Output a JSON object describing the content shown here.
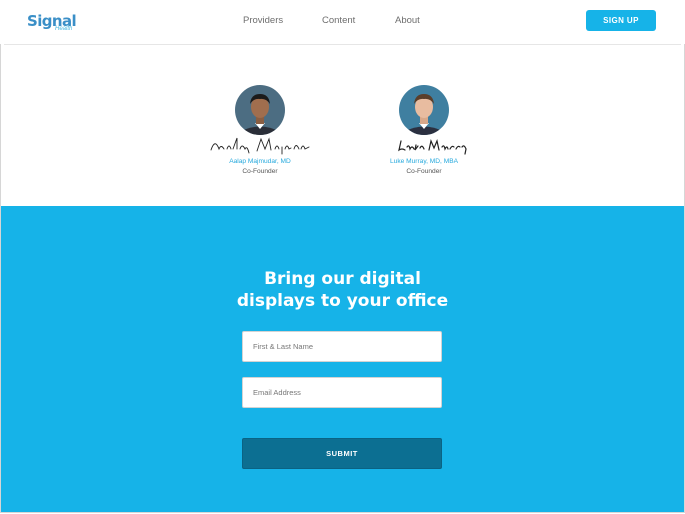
{
  "brand": {
    "logo_text": "Signal",
    "logo_sub": "Health",
    "primary_color": "#16b3e8",
    "accent_text_color": "#26a9dd"
  },
  "header": {
    "nav": [
      "Providers",
      "Content",
      "About"
    ],
    "signup_label": "SIGN UP"
  },
  "founders": [
    {
      "name": "Aalap Majmudar, MD",
      "role": "Co-Founder",
      "icon": "portrait-photo"
    },
    {
      "name": "Luke Murray, MD, MBA",
      "role": "Co-Founder",
      "icon": "portrait-photo"
    }
  ],
  "cta": {
    "title_line1": "Bring our digital",
    "title_line2": "displays to your office",
    "name_placeholder": "First & Last Name",
    "email_placeholder": "Email Address",
    "submit_label": "SUBMIT"
  }
}
